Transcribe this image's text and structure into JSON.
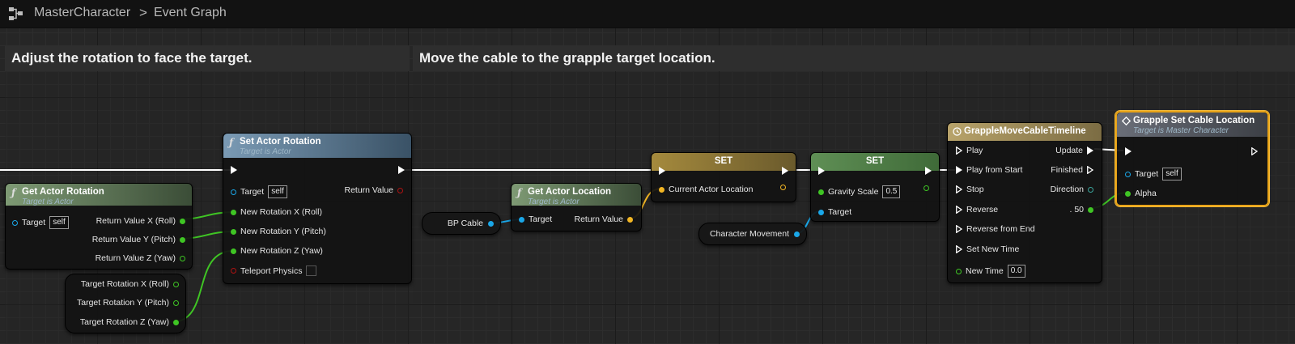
{
  "breadcrumb": {
    "blueprint": "MasterCharacter",
    "separator": ">",
    "graph": "Event Graph"
  },
  "icons": {
    "graph": "graph-nodes-icon",
    "function": "function-icon",
    "timeline": "clock-icon",
    "event": "diamond-icon"
  },
  "colors": {
    "exec_wire": "#ffffff",
    "float_wire": "#3fc524",
    "object_wire": "#1aa7e8",
    "vector_wire": "#f2b624",
    "selection": "#e8a317"
  },
  "comments": [
    {
      "title": "Adjust the rotation to face the target."
    },
    {
      "title": "Move the cable to the grapple target location."
    }
  ],
  "nodes": {
    "get_actor_rotation": {
      "title": "Get Actor Rotation",
      "subtitle": "Target is Actor",
      "target_label": "Target",
      "target_value": "self",
      "out_x": "Return Value X (Roll)",
      "out_y": "Return Value Y (Pitch)",
      "out_z": "Return Value Z (Yaw)"
    },
    "set_actor_rotation": {
      "title": "Set Actor Rotation",
      "subtitle": "Target is Actor",
      "target_label": "Target",
      "target_value": "self",
      "return_label": "Return Value",
      "in_x": "New Rotation X (Roll)",
      "in_y": "New Rotation Y (Pitch)",
      "in_z": "New Rotation Z (Yaw)",
      "teleport": "Teleport Physics"
    },
    "target_rotation": {
      "x": "Target Rotation X (Roll)",
      "y": "Target Rotation Y (Pitch)",
      "z": "Target Rotation Z (Yaw)"
    },
    "bp_cable": {
      "label": "BP Cable"
    },
    "get_actor_location": {
      "title": "Get Actor Location",
      "subtitle": "Target is Actor",
      "target_label": "Target",
      "return_label": "Return Value"
    },
    "set_location": {
      "title": "SET",
      "pin": "Current Actor Location"
    },
    "set_gravity": {
      "title": "SET",
      "pin": "Gravity Scale",
      "value": "0.5",
      "target_label": "Target"
    },
    "character_movement": {
      "label": "Character Movement"
    },
    "timeline": {
      "title": "GrappleMoveCableTimeline",
      "play": "Play",
      "play_from_start": "Play from Start",
      "stop": "Stop",
      "reverse": "Reverse",
      "reverse_from_end": "Reverse from End",
      "set_new_time": "Set New Time",
      "new_time": "New Time",
      "new_time_value": "0.0",
      "update": "Update",
      "finished": "Finished",
      "direction": "Direction",
      "track": ". 50"
    },
    "grapple_set_cable": {
      "title": "Grapple Set Cable Location",
      "subtitle": "Target is Master Character",
      "target_label": "Target",
      "target_value": "self",
      "alpha": "Alpha"
    }
  }
}
